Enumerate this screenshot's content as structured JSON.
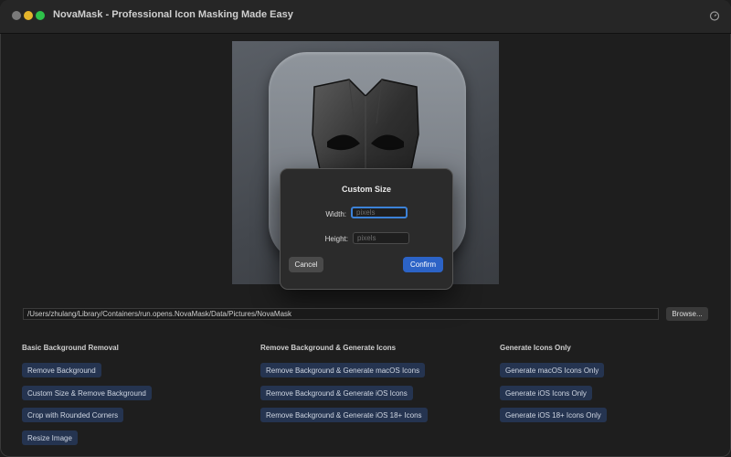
{
  "window": {
    "title": "NovaMask - Professional Icon Masking Made Easy"
  },
  "dialog": {
    "title": "Custom Size",
    "width_label": "Width:",
    "width_placeholder": "pixels",
    "height_label": "Height:",
    "height_placeholder": "pixels",
    "cancel_label": "Cancel",
    "confirm_label": "Confirm"
  },
  "path": {
    "value": "/Users/zhulang/Library/Containers/run.opens.NovaMask/Data/Pictures/NovaMask",
    "browse_label": "Browse..."
  },
  "sections": {
    "basic": {
      "title": "Basic Background Removal",
      "buttons": [
        "Remove Background",
        "Custom Size & Remove Background",
        "Crop with Rounded Corners",
        "Resize Image"
      ]
    },
    "remove_generate": {
      "title": "Remove Background & Generate Icons",
      "buttons": [
        "Remove Background & Generate macOS Icons",
        "Remove Background & Generate iOS Icons",
        "Remove Background & Generate iOS 18+ Icons"
      ]
    },
    "generate_only": {
      "title": "Generate Icons Only",
      "buttons": [
        "Generate macOS Icons Only",
        "Generate iOS Icons Only",
        "Generate iOS 18+ Icons Only"
      ]
    }
  },
  "colors": {
    "accent": "#2c63c6",
    "action_button": "#253450",
    "background": "#1e1e1e"
  }
}
